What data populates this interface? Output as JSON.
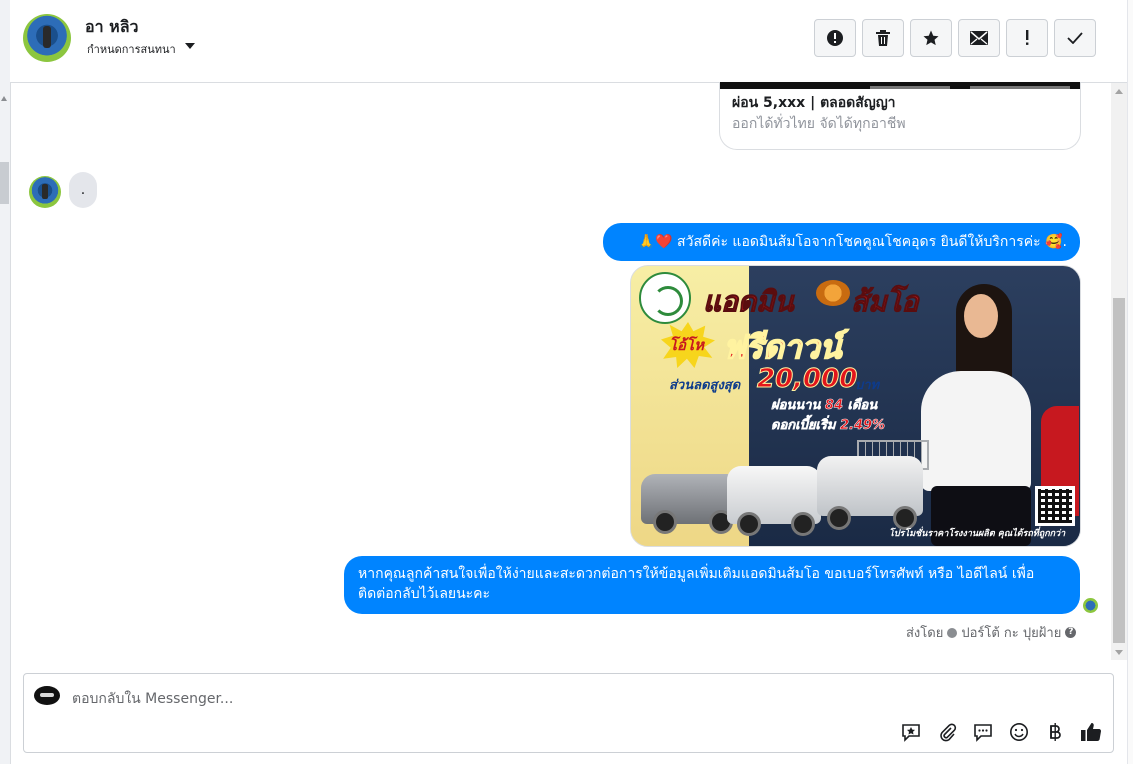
{
  "header": {
    "contact_name": "อา หลิว",
    "assign_label": "กำหนดการสนทนา",
    "toolbar": [
      {
        "name": "report-spam-button",
        "icon": "exclamation-circle-icon"
      },
      {
        "name": "delete-button",
        "icon": "trash-icon"
      },
      {
        "name": "star-button",
        "icon": "star-icon"
      },
      {
        "name": "mark-unread-button",
        "icon": "envelope-icon"
      },
      {
        "name": "mark-important-button",
        "icon": "exclamation-icon"
      },
      {
        "name": "mark-done-button",
        "icon": "check-icon"
      }
    ]
  },
  "messages": {
    "ad_card": {
      "title": "ผ่อน 5,xxx | ตลอดสัญญา",
      "subtitle": "ออกได้ทั่วไทย จัดได้ทุกอาชีพ"
    },
    "incoming": ".",
    "outgoing_greeting": "🙏❤️ สวัสดีค่ะ แอดมินส้มโอจากโชคคูณโชคอุดร ยินดีให้บริการค่ะ 🥰.",
    "promo_image": {
      "title_left": "แอดมิน",
      "title_right": "ส้มโอ",
      "burst": "โอ้โห",
      "headline": "ฟรีดาวน์",
      "discount_label": "ส่วนลดสูงสุด",
      "discount_value": "20,000",
      "discount_unit": "บาท",
      "installment_prefix": "ผ่อนนาน",
      "installment_months": "84",
      "installment_suffix": "เดือน",
      "interest_prefix": "ดอกเบี้ยเริ่ม",
      "interest_rate": "2.49%",
      "footer": "โปรโมชั่นราคาโรงงานผลิต คุณได้รถที่ถูกกว่า"
    },
    "outgoing_request": "หากคุณลูกค้าสนใจเพื่อให้ง่ายและสะดวกต่อการให้ข้อมูลเพิ่มเติมแอดมินส้มโอ ขอเบอร์โทรศัพท์ หรือ ไอดีไลน์ เพื่อติดต่อกลับไว้เลยนะคะ",
    "sent_by_label": "ส่งโดย",
    "sent_by_name": "ปอร์โต้ กะ ปุยฝ้าย"
  },
  "composer": {
    "placeholder": "ตอบกลับใน Messenger...",
    "icons": [
      "saved-reply-icon",
      "attachment-icon",
      "chat-bubble-icon",
      "emoji-icon",
      "baht-icon",
      "thumbs-up-icon"
    ]
  },
  "colors": {
    "accent": "#0084ff",
    "incoming_bubble": "#e4e6eb",
    "text_secondary": "#65676b"
  }
}
